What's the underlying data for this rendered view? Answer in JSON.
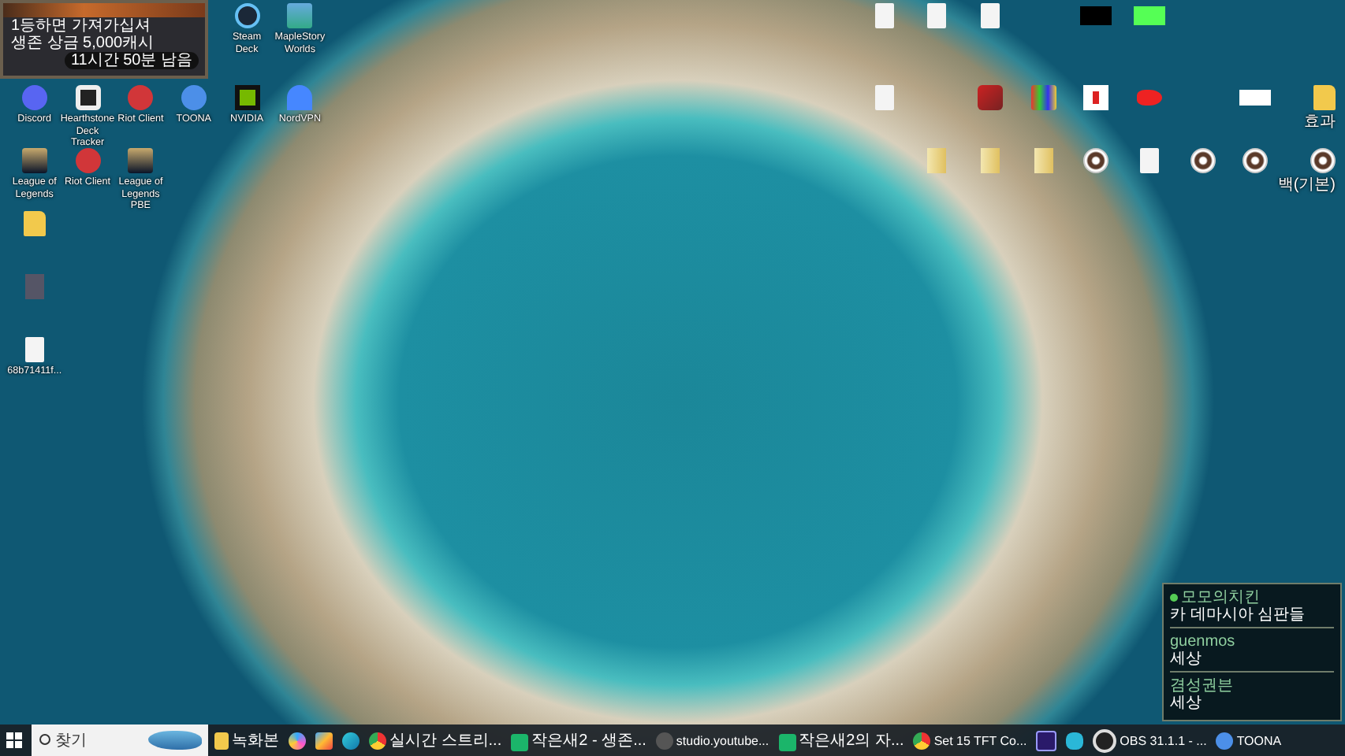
{
  "event_banner": {
    "lines": [
      "1등하면 가져가십셔",
      "생존 상금 5,000캐시"
    ],
    "timer": "11시간 50분 남음"
  },
  "desktop_icons": [
    {
      "label": "Steam Deck"
    },
    {
      "label": "MapleStory Worlds"
    },
    {
      "label": "Discord"
    },
    {
      "label": "Hearthstone Deck Tracker"
    },
    {
      "label": "Riot Client"
    },
    {
      "label": "TOONA"
    },
    {
      "label": "NVIDIA"
    },
    {
      "label": "NordVPN"
    },
    {
      "label": "효과"
    },
    {
      "label": "League of Legends"
    },
    {
      "label": "Riot Client"
    },
    {
      "label": "League of Legends PBE"
    },
    {
      "label": "백(기본)"
    },
    {
      "label": "68b71411f..."
    }
  ],
  "chat_overlay": {
    "messages": [
      {
        "author": "모모의치킨",
        "text": "카 데마시아 심판들",
        "online": true
      },
      {
        "author": "guenmos",
        "text": "세상",
        "online": false
      },
      {
        "author": "겸성권븐",
        "text": "세상",
        "online": false
      }
    ]
  },
  "taskbar": {
    "search": {
      "placeholder": "찾기"
    },
    "items": [
      {
        "kind": "window",
        "label": "녹화본"
      },
      {
        "kind": "pinned"
      },
      {
        "kind": "pinned"
      },
      {
        "kind": "pinned"
      },
      {
        "kind": "window",
        "label": "실시간 스트리..."
      },
      {
        "kind": "window",
        "label": "작은새2 - 생존..."
      },
      {
        "kind": "window",
        "label": "studio.youtube..."
      },
      {
        "kind": "window",
        "label": "작은새2의 자..."
      },
      {
        "kind": "window",
        "label": "Set 15 TFT Co..."
      },
      {
        "kind": "pinned"
      },
      {
        "kind": "pinned"
      },
      {
        "kind": "window",
        "label": "OBS 31.1.1 - ..."
      },
      {
        "kind": "window",
        "label": "TOONA"
      }
    ]
  }
}
